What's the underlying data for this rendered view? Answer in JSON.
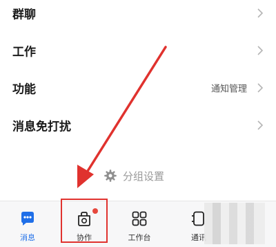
{
  "settings": {
    "rows": [
      {
        "label": "群聊",
        "value": ""
      },
      {
        "label": "工作",
        "value": ""
      },
      {
        "label": "功能",
        "value": "通知管理"
      },
      {
        "label": "消息免打扰",
        "value": ""
      }
    ],
    "group_settings_label": "分组设置"
  },
  "tab_bar": {
    "tabs": [
      {
        "label": "消息",
        "icon": "chat-bubble-icon",
        "active": true
      },
      {
        "label": "协作",
        "icon": "collaboration-icon",
        "badge": true
      },
      {
        "label": "工作台",
        "icon": "grid-icon"
      },
      {
        "label": "通讯",
        "icon": "contacts-icon"
      }
    ]
  },
  "colors": {
    "accent": "#1f6fe8",
    "annotation_red": "#e0322e",
    "badge_red": "#e6483d",
    "muted_text": "#9a9a9a"
  }
}
